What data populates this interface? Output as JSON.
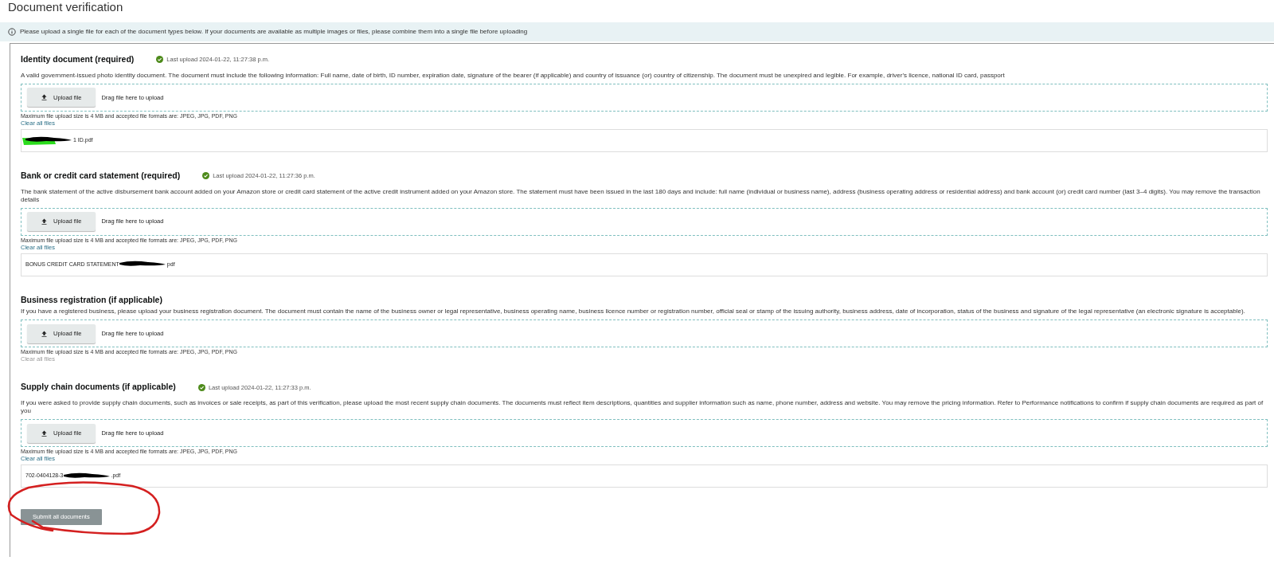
{
  "page_title": "Document verification",
  "banner": {
    "text": "Please upload a single file for each of the document types below. If your documents are available as multiple images or files, please combine them into a single file before uploading"
  },
  "sections": [
    {
      "title": "Identity document (required)",
      "last_upload": "Last upload 2024-01-22, 11:27:38 p.m.",
      "description": "A valid government-issued photo identity document. The document must include the following information: Full name, date of birth, ID number, expiration date, signature of the bearer (if applicable) and country of issuance (or) country of citizenship. The document must be unexpired and legible. For example, driver's licence, national ID card, passport",
      "upload_button": "Upload file",
      "drop_hint": "Drag file here to upload",
      "limits": "Maximum file upload size is 4 MB and accepted file formats are: JPEG, JPG, PDF, PNG",
      "clear_all": {
        "label": "Clear all files",
        "disabled": false
      },
      "files": [
        {
          "name_end": "1 ID.pdf",
          "redacted": true,
          "highlighted": true
        }
      ]
    },
    {
      "title": "Bank or credit card statement (required)",
      "last_upload": "Last upload 2024-01-22, 11:27:36 p.m.",
      "description": "The bank statement of the active disbursement bank account added on your Amazon store or credit card statement of the active credit instrument added on your Amazon store. The statement must have been issued in the last 180 days and include: full name (individual or business name), address (business operating address or residential address) and bank account (or) credit card number (last 3–4 digits). You may remove the transaction details",
      "upload_button": "Upload file",
      "drop_hint": "Drag file here to upload",
      "limits": "Maximum file upload size is 4 MB and accepted file formats are: JPEG, JPG, PDF, PNG",
      "clear_all": {
        "label": "Clear all files",
        "disabled": false
      },
      "files": [
        {
          "name_start": "BONUS CREDIT CARD STATEMENT",
          "name_end": "pdf",
          "redacted": true,
          "highlighted": false
        }
      ]
    },
    {
      "title": "Business registration (if applicable)",
      "description": "If you have a registered business, please upload your business registration document. The document must contain the name of the business owner or legal representative, business operating name, business licence number or registration number, official seal or stamp of the issuing authority, business address, date of incorporation, status of the business and signature of the legal representative (an electronic signature is acceptable).",
      "upload_button": "Upload file",
      "drop_hint": "Drag file here to upload",
      "limits": "Maximum file upload size is 4 MB and accepted file formats are: JPEG, JPG, PDF, PNG",
      "clear_all": {
        "label": "Clear all files",
        "disabled": true
      }
    },
    {
      "title": "Supply chain documents (if applicable)",
      "last_upload": "Last upload 2024-01-22, 11:27:33 p.m.",
      "description": "If you were asked to provide supply chain documents, such as invoices or sale receipts, as part of this verification, please upload the most recent supply chain documents. The documents must reflect item descriptions, quantities and supplier information such as name, phone number, address and website. You may remove the pricing information. Refer to Performance notifications to confirm if supply chain documents are required as part of you",
      "upload_button": "Upload file",
      "drop_hint": "Drag file here to upload",
      "limits": "Maximum file upload size is 4 MB and accepted file formats are: JPEG, JPG, PDF, PNG",
      "clear_all": {
        "label": "Clear all files",
        "disabled": false
      },
      "files": [
        {
          "name_start": "702-0404128-3",
          "name_end": ".pdf",
          "redacted": true,
          "highlighted": false
        }
      ]
    }
  ],
  "submit": {
    "label": "Submit all documents",
    "disabled": true
  },
  "annotation": {
    "kind": "circle"
  }
}
